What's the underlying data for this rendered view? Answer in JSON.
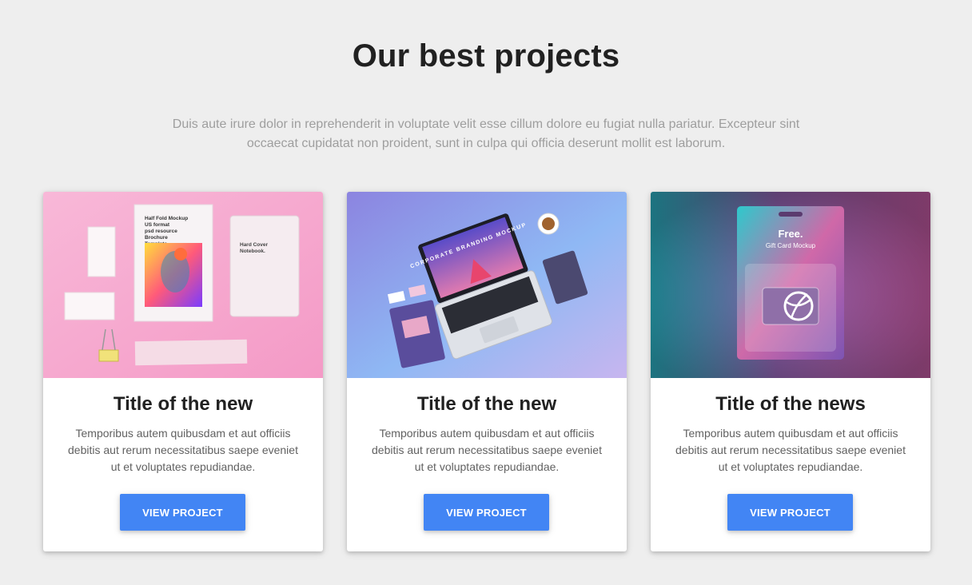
{
  "section": {
    "title": "Our best projects",
    "description": "Duis aute irure dolor in reprehenderit in voluptate velit esse cillum dolore eu fugiat nulla pariatur. Excepteur sint occaecat cupidatat non proident, sunt in culpa qui officia deserunt mollit est laborum."
  },
  "colors": {
    "background": "#eeeeee",
    "button": "#4285f4",
    "title": "#212121",
    "body_text": "#616161",
    "lead_text": "#9e9e9e"
  },
  "cards": [
    {
      "title": "Title of the new",
      "text": "Temporibus autem quibusdam et aut officiis debitis aut rerum necessitatibus saepe eveniet ut et voluptates repudiandae.",
      "button": "VIEW PROJECT",
      "image": {
        "kind": "branding-stationery-mockup",
        "brochure_text": "Half Fold Mockup US format psd resource Brochure Template.",
        "notebook_text": "Hard Cover Notebook."
      }
    },
    {
      "title": "Title of the new",
      "text": "Temporibus autem quibusdam et aut officiis debitis aut rerum necessitatibus saepe eveniet ut et voluptates repudiandae.",
      "button": "VIEW PROJECT",
      "image": {
        "kind": "laptop-corporate-branding-mockup",
        "screen_text": "CORPORATE BRANDING MOCKUP"
      }
    },
    {
      "title": "Title of the news",
      "text": "Temporibus autem quibusdam et aut officiis debitis aut rerum necessitatibus saepe eveniet ut et voluptates repudiandae.",
      "button": "VIEW PROJECT",
      "image": {
        "kind": "gift-card-mockup",
        "headline": "Free.",
        "subline": "Gift Card Mockup"
      }
    }
  ]
}
